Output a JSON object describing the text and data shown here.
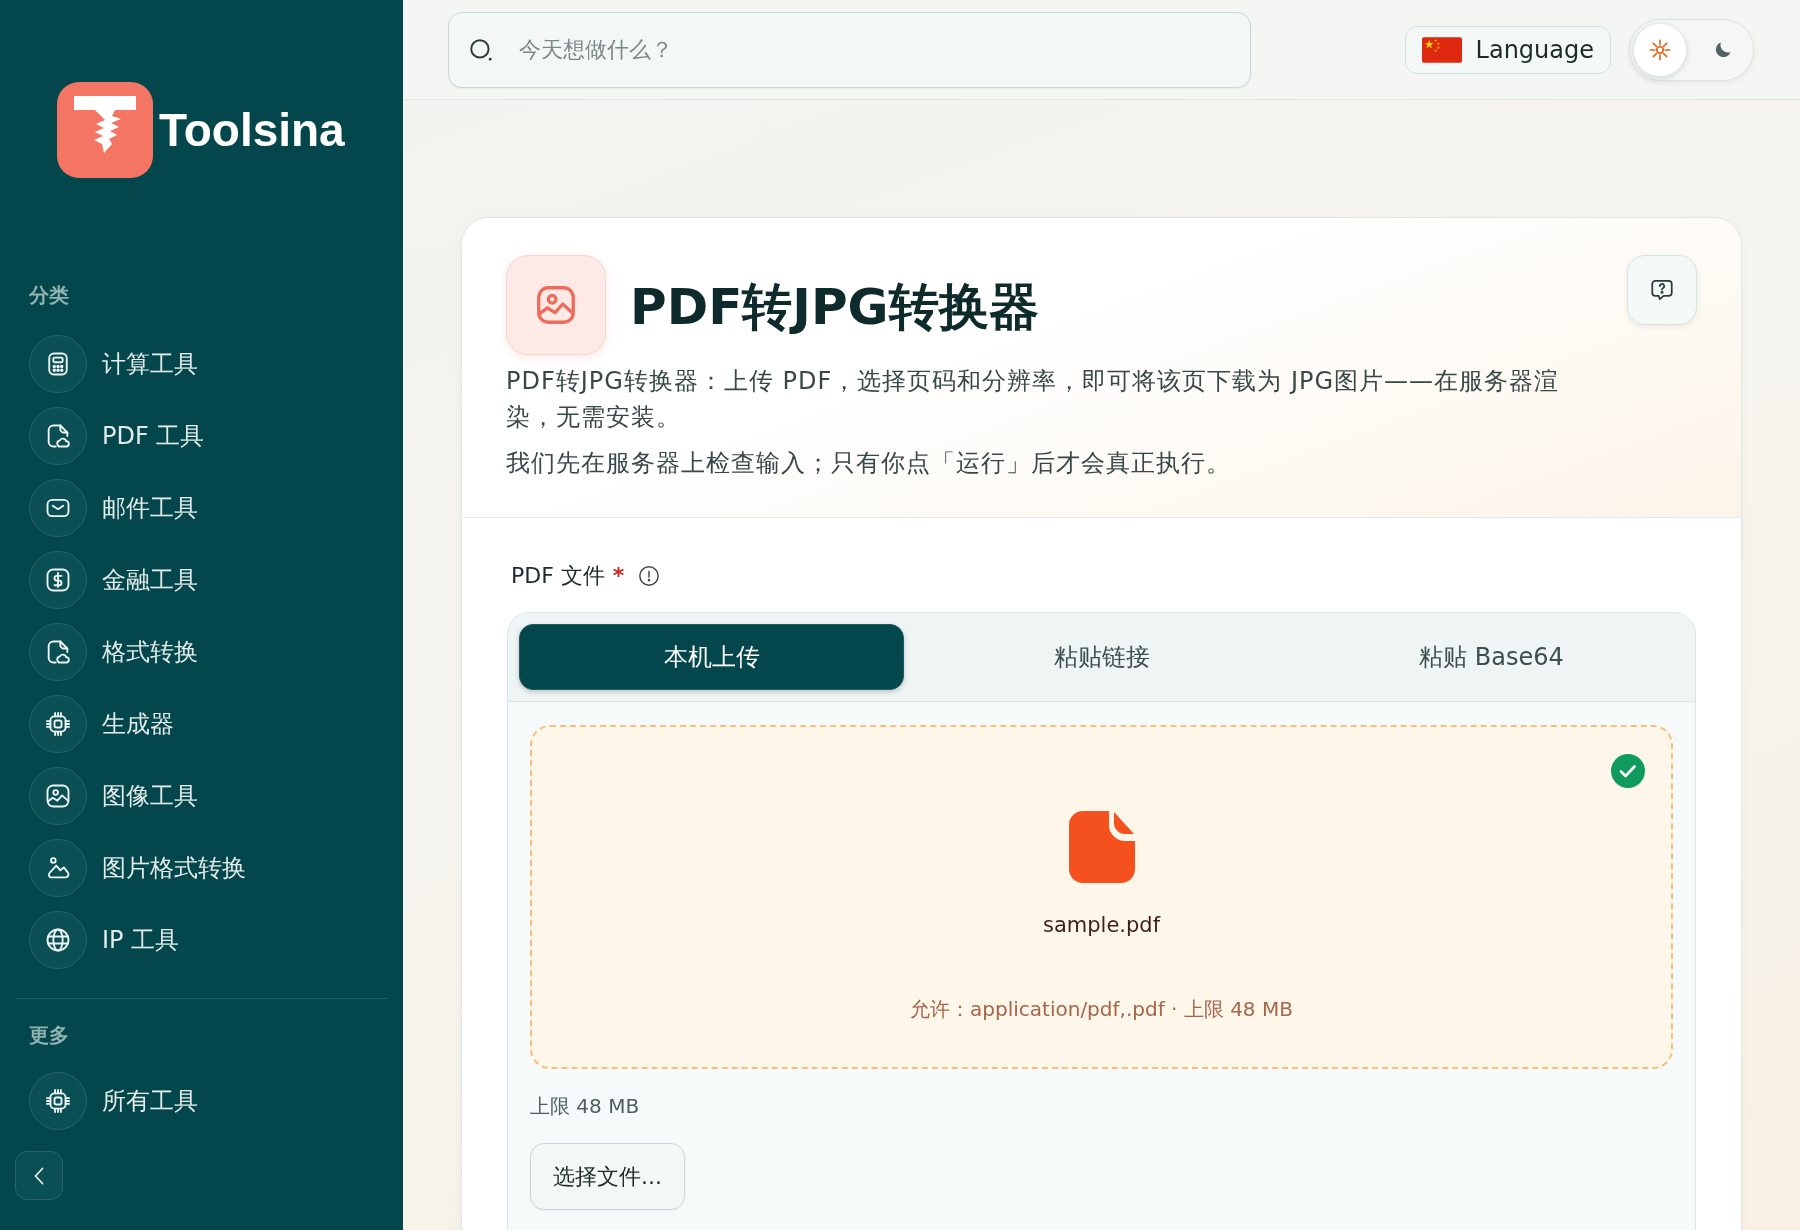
{
  "sidebar": {
    "brand": "Toolsina",
    "sections": [
      {
        "title": "分类",
        "items": [
          {
            "label": "计算工具"
          },
          {
            "label": "PDF 工具"
          },
          {
            "label": "邮件工具"
          },
          {
            "label": "金融工具"
          },
          {
            "label": "格式转换"
          },
          {
            "label": "生成器"
          },
          {
            "label": "图像工具"
          },
          {
            "label": "图片格式转换"
          },
          {
            "label": "IP 工具"
          }
        ]
      },
      {
        "title": "更多",
        "items": [
          {
            "label": "所有工具"
          }
        ]
      }
    ]
  },
  "topbar": {
    "search": {
      "placeholder": "今天想做什么？"
    },
    "language": {
      "label": "Language"
    },
    "theme_toggle": [
      {
        "kind": "light",
        "selected": true
      },
      {
        "kind": "dark",
        "selected": false
      }
    ]
  },
  "tool": {
    "title": "PDF转JPG转换器",
    "description": [
      "PDF转JPG转换器：上传 PDF，选择页码和分辨率，即可将该页下载为 JPG图片——在服务器渲染，无需安装。",
      "我们先在服务器上检查输入；只有你点「运行」后才会真正执行。"
    ],
    "field": {
      "label": "PDF 文件",
      "required_mark": "*",
      "tabs": [
        {
          "label": "本机上传",
          "selected": true
        },
        {
          "label": "粘贴链接",
          "selected": false
        },
        {
          "label": "粘贴 Base64",
          "selected": false
        }
      ],
      "dropzone": {
        "valid": true,
        "file_name": "sample.pdf",
        "accepted": "允许：application/pdf,.pdf · 上限 48 MB"
      },
      "limit": "上限 48 MB",
      "choose_button": "选择文件..."
    }
  }
}
